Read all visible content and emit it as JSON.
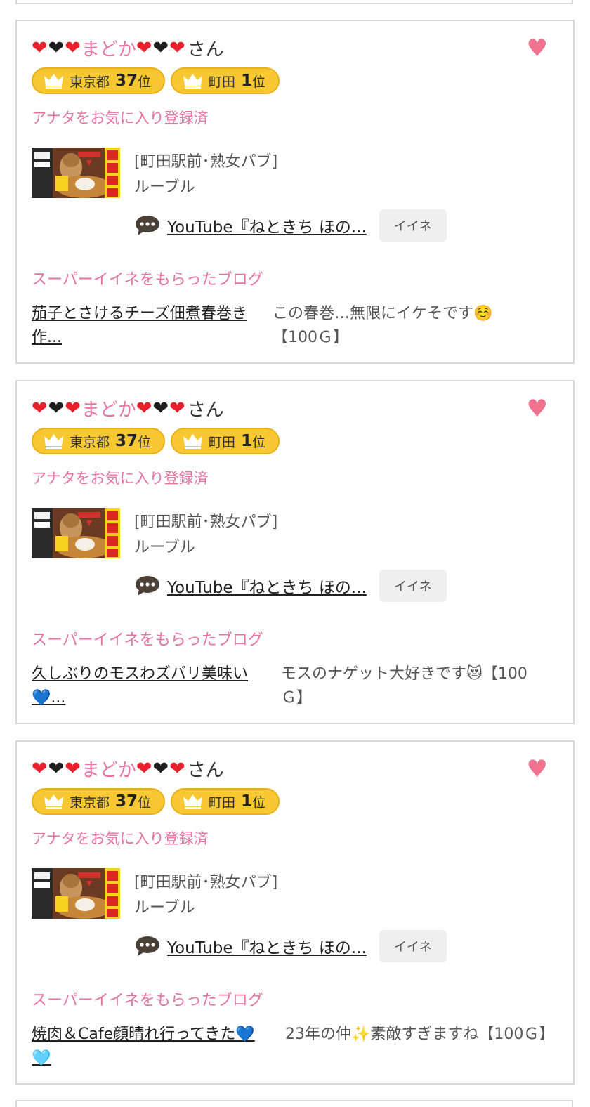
{
  "colors": {
    "pink": "#e7739f",
    "heart_red": "#e8202c",
    "badge_gold": "#f7c832",
    "favorite_heart": "#f0728e"
  },
  "cards": [
    {
      "hearts_left": [
        "❤",
        "❤",
        "❤"
      ],
      "name": "まどか",
      "hearts_right": [
        "❤",
        "❤",
        "❤"
      ],
      "suffix": "さん",
      "badge_tokyo": {
        "label": "東京都",
        "rank": "37",
        "unit": "位"
      },
      "badge_machida": {
        "label": "町田",
        "rank": "1",
        "unit": "位"
      },
      "favorite_status": "アナタをお気に入り登録済",
      "shop_category": "[町田駅前･熟女パブ]",
      "shop_name": "ルーブル",
      "youtube_link": "YouTube『ねときち ほの...",
      "iine_label": "イイネ",
      "super_iine_label": "スーパーイイネをもらったブログ",
      "blog_title": "茄子とさけるチーズ佃煮春巻き作...",
      "blog_comment": "この春巻…無限にイケそです☺️【100Ｇ】"
    },
    {
      "hearts_left": [
        "❤",
        "❤",
        "❤"
      ],
      "name": "まどか",
      "hearts_right": [
        "❤",
        "❤",
        "❤"
      ],
      "suffix": "さん",
      "badge_tokyo": {
        "label": "東京都",
        "rank": "37",
        "unit": "位"
      },
      "badge_machida": {
        "label": "町田",
        "rank": "1",
        "unit": "位"
      },
      "favorite_status": "アナタをお気に入り登録済",
      "shop_category": "[町田駅前･熟女パブ]",
      "shop_name": "ルーブル",
      "youtube_link": "YouTube『ねときち ほの...",
      "iine_label": "イイネ",
      "super_iine_label": "スーパーイイネをもらったブログ",
      "blog_title": "久しぶりのモスわズバリ美味い💙...",
      "blog_comment": "モスのナゲット大好きです😻【100Ｇ】"
    },
    {
      "hearts_left": [
        "❤",
        "❤",
        "❤"
      ],
      "name": "まどか",
      "hearts_right": [
        "❤",
        "❤",
        "❤"
      ],
      "suffix": "さん",
      "badge_tokyo": {
        "label": "東京都",
        "rank": "37",
        "unit": "位"
      },
      "badge_machida": {
        "label": "町田",
        "rank": "1",
        "unit": "位"
      },
      "favorite_status": "アナタをお気に入り登録済",
      "shop_category": "[町田駅前･熟女パブ]",
      "shop_name": "ルーブル",
      "youtube_link": "YouTube『ねときち ほの...",
      "iine_label": "イイネ",
      "super_iine_label": "スーパーイイネをもらったブログ",
      "blog_title": "焼肉＆Cafe顔晴れ行ってきた💙🩵",
      "blog_comment": "23年の仲✨素敵すぎますね【100Ｇ】"
    }
  ]
}
